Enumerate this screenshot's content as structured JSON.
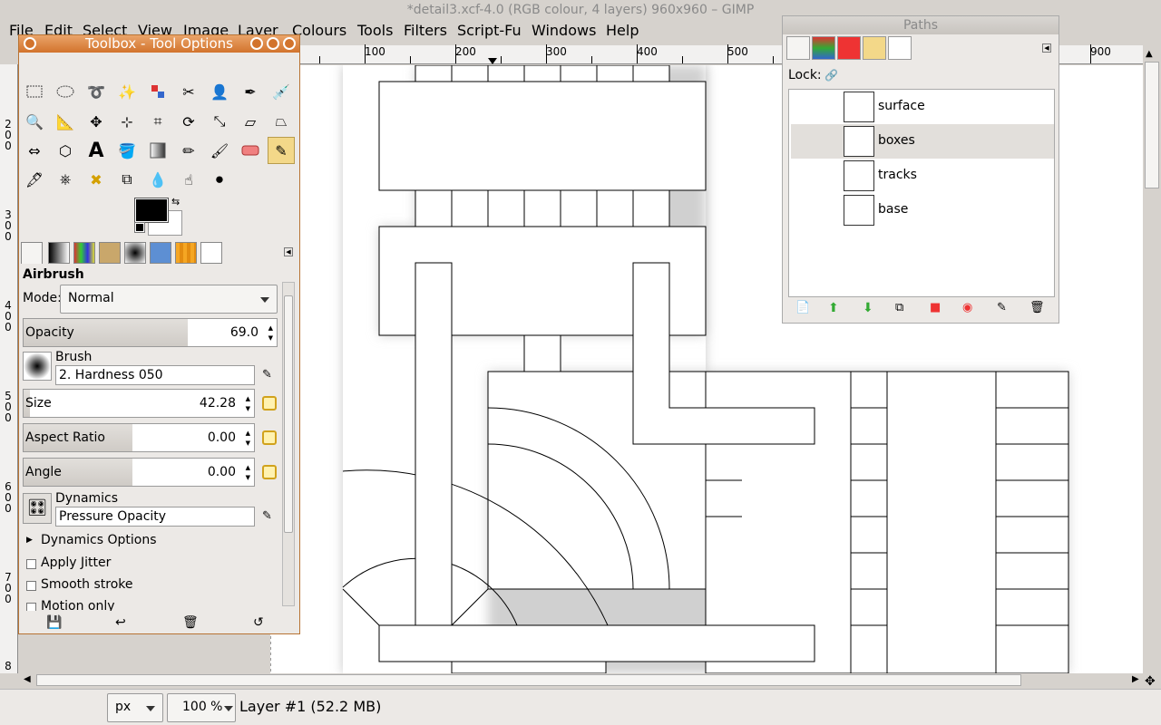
{
  "window": {
    "title": "*detail3.xcf-4.0 (RGB colour, 4 layers) 960x960 – GIMP"
  },
  "menu": [
    "File",
    "Edit",
    "Select",
    "View",
    "Image",
    "Layer",
    "Colours",
    "Tools",
    "Filters",
    "Script-Fu",
    "Windows",
    "Help"
  ],
  "ruler": {
    "h_labels": [
      "100",
      "200",
      "300",
      "400",
      "500",
      "900"
    ],
    "v_labels": [
      "2\n0\n0",
      "3\n0\n0",
      "4\n0\n0",
      "5\n0\n0",
      "6\n0\n0",
      "7\n0\n0",
      "8"
    ]
  },
  "toolbox": {
    "title": "Toolbox - Tool Options",
    "tool_name": "Airbrush",
    "mode_label": "Mode:",
    "mode_value": "Normal",
    "opacity_label": "Opacity",
    "opacity_value": "69.0",
    "opacity_fraction": 0.69,
    "brush_label": "Brush",
    "brush_value": "2. Hardness 050",
    "size_label": "Size",
    "size_value": "42.28",
    "aspect_label": "Aspect Ratio",
    "aspect_value": "0.00",
    "angle_label": "Angle",
    "angle_value": "0.00",
    "dynamics_label": "Dynamics",
    "dynamics_value": "Pressure Opacity",
    "dynamics_options": "Dynamics Options",
    "apply_jitter": "Apply Jitter",
    "smooth_stroke": "Smooth stroke",
    "motion_only": "Motion only",
    "active_tool": "airbrush"
  },
  "paths": {
    "title": "Paths",
    "lock_label": "Lock:",
    "items": [
      {
        "name": "surface",
        "selected": false
      },
      {
        "name": "boxes",
        "selected": true
      },
      {
        "name": "tracks",
        "selected": false
      },
      {
        "name": "base",
        "selected": false
      }
    ]
  },
  "status": {
    "unit": "px",
    "zoom": "100 %",
    "layer_info": "Layer #1 (52.2 MB)"
  }
}
